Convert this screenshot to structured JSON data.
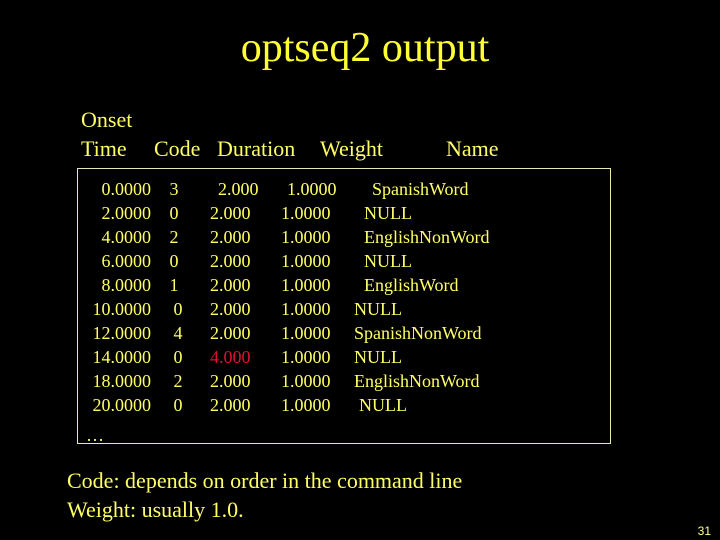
{
  "title": "optseq2 output",
  "headers": {
    "onset_line1": "Onset",
    "time": "Time",
    "code": "Code",
    "duration": "Duration",
    "weight": "Weight",
    "name": "Name"
  },
  "rows": [
    {
      "onset": "0.0000",
      "code": "3",
      "duration": "2.000",
      "weight": "1.0000",
      "name": "SpanishWord"
    },
    {
      "onset": "2.0000",
      "code": "0",
      "duration": "2.000",
      "weight": "1.0000",
      "name": "NULL"
    },
    {
      "onset": "4.0000",
      "code": "2",
      "duration": "2.000",
      "weight": "1.0000",
      "name": "EnglishNonWord"
    },
    {
      "onset": "6.0000",
      "code": "0",
      "duration": "2.000",
      "weight": "1.0000",
      "name": "NULL"
    },
    {
      "onset": "8.0000",
      "code": "1",
      "duration": "2.000",
      "weight": "1.0000",
      "name": "EnglishWord"
    },
    {
      "onset": "10.0000",
      "code": "0",
      "duration": "2.000",
      "weight": "1.0000",
      "name": "NULL"
    },
    {
      "onset": "12.0000",
      "code": "4",
      "duration": "2.000",
      "weight": "1.0000",
      "name": "SpanishNonWord"
    },
    {
      "onset": "14.0000",
      "code": "0",
      "duration": "4.000",
      "weight": "1.0000",
      "name": "NULL",
      "highlight": true
    },
    {
      "onset": "18.0000",
      "code": "2",
      "duration": "2.000",
      "weight": "1.0000",
      "name": "EnglishNonWord"
    },
    {
      "onset": "20.0000",
      "code": "0",
      "duration": "2.000",
      "weight": "1.0000",
      "name": "NULL"
    }
  ],
  "ellipsis": "…",
  "notes": [
    "Code: depends on order in the command line",
    "Weight: usually 1.0."
  ],
  "page_number": "31",
  "colors": {
    "background": "#000000",
    "text": "#ffff66",
    "highlight": "#dd1133"
  }
}
